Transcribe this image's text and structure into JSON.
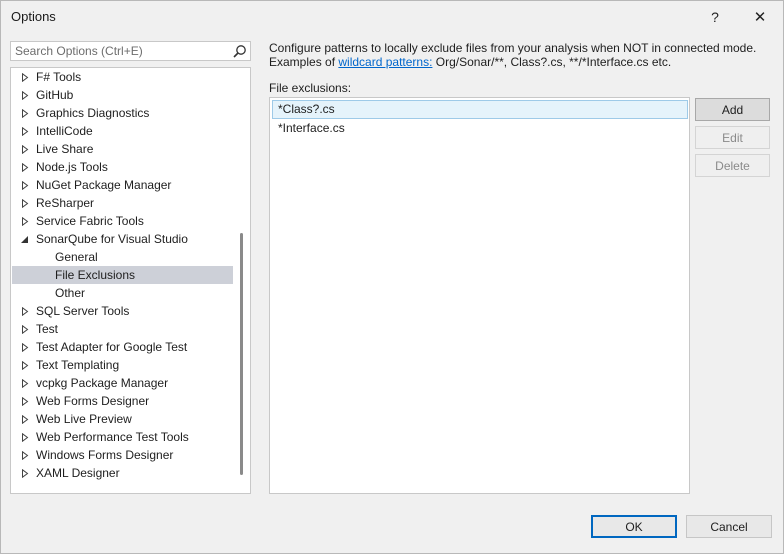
{
  "window": {
    "title": "Options",
    "help_glyph": "?",
    "close_glyph": "✕"
  },
  "search": {
    "placeholder": "Search Options (Ctrl+E)",
    "value": ""
  },
  "tree": {
    "items": [
      {
        "label": "F# Tools",
        "level": 0,
        "expander": "collapsed"
      },
      {
        "label": "GitHub",
        "level": 0,
        "expander": "collapsed"
      },
      {
        "label": "Graphics Diagnostics",
        "level": 0,
        "expander": "collapsed"
      },
      {
        "label": "IntelliCode",
        "level": 0,
        "expander": "collapsed"
      },
      {
        "label": "Live Share",
        "level": 0,
        "expander": "collapsed"
      },
      {
        "label": "Node.js Tools",
        "level": 0,
        "expander": "collapsed"
      },
      {
        "label": "NuGet Package Manager",
        "level": 0,
        "expander": "collapsed"
      },
      {
        "label": "ReSharper",
        "level": 0,
        "expander": "collapsed"
      },
      {
        "label": "Service Fabric Tools",
        "level": 0,
        "expander": "collapsed"
      },
      {
        "label": "SonarQube for Visual Studio",
        "level": 0,
        "expander": "expanded"
      },
      {
        "label": "General",
        "level": 1,
        "expander": "none"
      },
      {
        "label": "File Exclusions",
        "level": 1,
        "expander": "none",
        "selected": true
      },
      {
        "label": "Other",
        "level": 1,
        "expander": "none"
      },
      {
        "label": "SQL Server Tools",
        "level": 0,
        "expander": "collapsed"
      },
      {
        "label": "Test",
        "level": 0,
        "expander": "collapsed"
      },
      {
        "label": "Test Adapter for Google Test",
        "level": 0,
        "expander": "collapsed"
      },
      {
        "label": "Text Templating",
        "level": 0,
        "expander": "collapsed"
      },
      {
        "label": "vcpkg Package Manager",
        "level": 0,
        "expander": "collapsed"
      },
      {
        "label": "Web Forms Designer",
        "level": 0,
        "expander": "collapsed"
      },
      {
        "label": "Web Live Preview",
        "level": 0,
        "expander": "collapsed"
      },
      {
        "label": "Web Performance Test Tools",
        "level": 0,
        "expander": "collapsed"
      },
      {
        "label": "Windows Forms Designer",
        "level": 0,
        "expander": "collapsed"
      },
      {
        "label": "XAML Designer",
        "level": 0,
        "expander": "collapsed"
      }
    ]
  },
  "content": {
    "description_line1": "Configure patterns to locally exclude files from your analysis when NOT in connected mode.",
    "description_prefix": "Examples of ",
    "description_link": "wildcard patterns:",
    "description_suffix": " Org/Sonar/**, Class?.cs, **/*Interface.cs etc.",
    "exclusions_label": "File exclusions:",
    "exclusions": [
      {
        "pattern": "*Class?.cs",
        "selected": true
      },
      {
        "pattern": "*Interface.cs",
        "selected": false
      }
    ]
  },
  "buttons": {
    "add": "Add",
    "edit": "Edit",
    "delete": "Delete",
    "ok": "OK",
    "cancel": "Cancel"
  },
  "colors": {
    "selected_tree_bg": "#cdd0d8",
    "selected_list_bg": "#e5f3fb",
    "link": "#0066cc",
    "default_button_border": "#0067c0"
  }
}
